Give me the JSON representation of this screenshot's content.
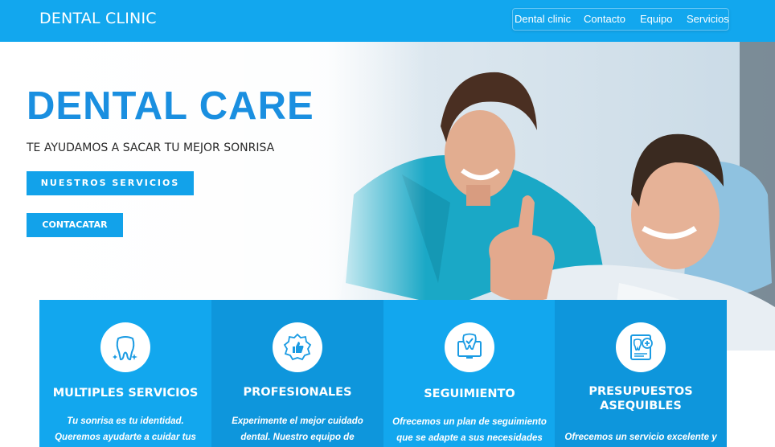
{
  "header": {
    "brand": "DENTAL CLINIC",
    "nav": [
      {
        "label": "Dental clinic"
      },
      {
        "label": "Contacto"
      },
      {
        "label": "Equipo"
      },
      {
        "label": "Servicios"
      }
    ]
  },
  "hero": {
    "title": "DENTAL CARE",
    "subtitle": "TE AYUDAMOS A SACAR TU MEJOR SONRISA",
    "primary_button": "NUESTROS SERVICIOS",
    "secondary_button": "CONTACATAR"
  },
  "features": [
    {
      "title": "MULTIPLES SERVICIOS",
      "text_lines": [
        "Tu sonrisa es tu identidad.",
        "Queremos ayudarte a cuidar tus"
      ],
      "icon": "tooth-sparkle-icon"
    },
    {
      "title": "PROFESIONALES",
      "text_lines": [
        "Experimente el mejor cuidado",
        "dental. Nuestro equipo de"
      ],
      "icon": "thumbs-up-badge-icon"
    },
    {
      "title": "SEGUIMIENTO",
      "text_lines": [
        "Ofrecemos un plan de seguimiento",
        "que se adapte a sus necesidades"
      ],
      "icon": "tooth-monitor-icon"
    },
    {
      "title_lines": [
        "PRESUPUESTOS",
        "ASEQUIBLES"
      ],
      "text_lines": [
        "Ofrecemos un servicio excelente y"
      ],
      "icon": "dental-report-icon"
    }
  ],
  "colors": {
    "primary": "#12a7ee",
    "title_blue": "#1a8fe0",
    "card_blue_a": "#12a7ee",
    "card_blue_b": "#0e96dc"
  }
}
